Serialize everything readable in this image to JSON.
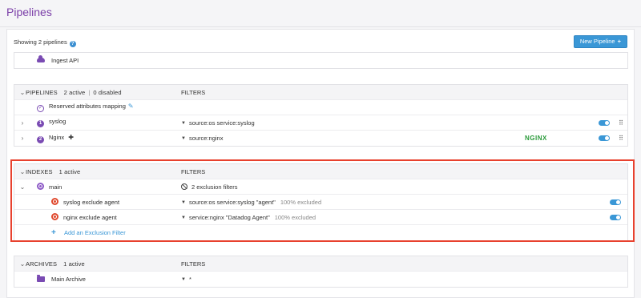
{
  "page": {
    "title": "Pipelines"
  },
  "toolbar": {
    "showing_text": "Showing 2 pipelines",
    "help_icon": "question-circle-icon",
    "new_pipeline_label": "New Pipeline",
    "new_pipeline_icon": "+"
  },
  "ingest": {
    "label": "Ingest API",
    "icon": "cloud-icon"
  },
  "pipelines": {
    "header_label": "PIPELINES",
    "active_count": "2 active",
    "separator": "|",
    "disabled_count": "0 disabled",
    "filters_header": "FILTERS",
    "reserved_label": "Reserved attributes mapping",
    "items": [
      {
        "number": "1",
        "name": "syslog",
        "filter": "source:os service:syslog",
        "enabled": true
      },
      {
        "number": "2",
        "name": "Nginx",
        "filter": "source:nginx",
        "logo": "NGINX",
        "enabled": true
      }
    ]
  },
  "indexes": {
    "header_label": "INDEXES",
    "active_count": "1 active",
    "filters_header": "FILTERS",
    "main": {
      "name": "main",
      "exclusion_summary": "2 exclusion filters"
    },
    "exclusions": [
      {
        "name": "syslog exclude agent",
        "filter": "source:os service:syslog \"agent\"",
        "excluded": "100% excluded",
        "enabled": true
      },
      {
        "name": "nginx exclude agent",
        "filter": "service:nginx \"Datadog Agent\"",
        "excluded": "100% excluded",
        "enabled": true
      }
    ],
    "add_label": "Add an Exclusion Filter",
    "add_icon": "+"
  },
  "archives": {
    "header_label": "ARCHIVES",
    "active_count": "1 active",
    "filters_header": "FILTERS",
    "items": [
      {
        "name": "Main Archive",
        "filter": "*"
      }
    ]
  },
  "colors": {
    "title": "#7b3fa8",
    "accent": "#3a97d6",
    "pipeline_badge": "#7a4bb3",
    "exclusion_icon": "#e04a2f",
    "highlight": "#e8412e",
    "nginx": "#2a9a3a"
  }
}
